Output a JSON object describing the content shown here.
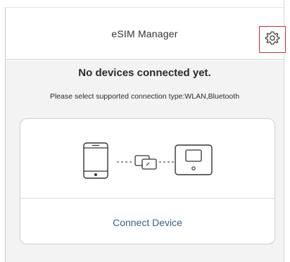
{
  "header": {
    "title": "eSIM Manager",
    "settings_icon": "gear-icon"
  },
  "main": {
    "headline": "No devices connected yet.",
    "instructions": "Please select supported connection type:WLAN,Bluetooth",
    "illustration_icons": [
      "smartphone-icon",
      "esim-card-icon",
      "router-icon"
    ],
    "connect_button_label": "Connect Device"
  },
  "colors": {
    "highlight_border": "#d62b2b",
    "link_text": "#3a5f8a",
    "content_background": "#f3f3f3"
  }
}
